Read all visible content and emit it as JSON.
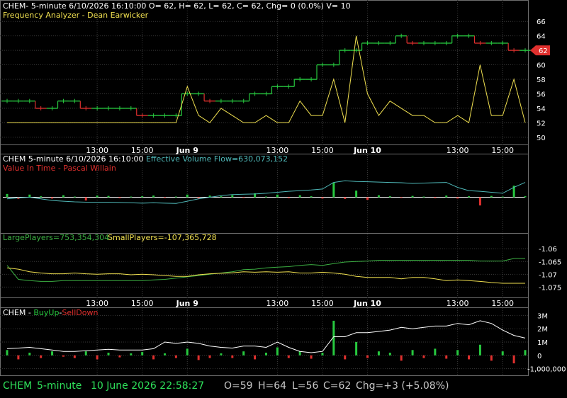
{
  "colors": {
    "background": "#000000",
    "grid": "#3a3a3a",
    "frame": "#6e6e6e",
    "up": "#27c93f",
    "down": "#e0302e",
    "yellow": "#f0e050",
    "cyan": "#4fb8b8",
    "green_line": "#3cb043",
    "white": "#ffffff",
    "status_green": "#2ee05a",
    "price_tag": "#e0302e"
  },
  "x_axis": {
    "tick_labels": [
      "13:00",
      "15:00",
      "Jun 9",
      "13:00",
      "15:00",
      "Jun 10",
      "13:00",
      "15:00"
    ],
    "tick_bold": [
      false,
      false,
      true,
      false,
      false,
      true,
      false,
      false
    ],
    "tick_index": [
      8,
      12,
      16,
      24,
      28,
      32,
      40,
      44
    ],
    "bar_count": 47
  },
  "panel1": {
    "header_line1": "CHEM- 5-minute 6/10/2026 16:10:00 O= 62, H= 62, L= 62, C= 62, Chg= 0 (0.0%) V= 10",
    "header_line2": "Frequency Analyzer - Dean Earwicker",
    "y_ticks": [
      "66",
      "64",
      "62",
      "60",
      "58",
      "56",
      "54",
      "52",
      "50"
    ],
    "last_price_label": "62",
    "chart_data": {
      "type": "line",
      "title": "",
      "ylim": [
        49,
        67
      ],
      "price_steps": [
        55,
        55,
        55,
        54,
        54,
        55,
        55,
        54,
        54,
        54,
        54,
        54,
        53,
        53,
        53,
        53,
        56,
        56,
        55,
        55,
        55,
        55,
        56,
        56,
        57,
        57,
        58,
        58,
        60,
        60,
        62,
        62,
        63,
        63,
        63,
        64,
        63,
        63,
        63,
        63,
        64,
        64,
        63,
        63,
        63,
        62,
        62
      ],
      "frequency": [
        52,
        52,
        52,
        52,
        52,
        52,
        52,
        52,
        52,
        52,
        52,
        52,
        52,
        52,
        52,
        52,
        57,
        53,
        52,
        54,
        53,
        52,
        52,
        53,
        52,
        52,
        55,
        53,
        53,
        58,
        52,
        64,
        56,
        53,
        55,
        54,
        53,
        53,
        52,
        52,
        53,
        52,
        60,
        53,
        53,
        58,
        52
      ]
    }
  },
  "panel2": {
    "header_line1_a": "CHEM 5-minute  6/10/2026 16:10:00 ",
    "header_line1_b": "Effective Volume Flow=630,073,152",
    "header_line2": "Value In Time - Pascal Willain",
    "chart_data": {
      "type": "line",
      "title": "",
      "ylim": [
        -1,
        1
      ],
      "histogram": [
        0.1,
        -0.05,
        0.08,
        0.03,
        -0.04,
        0.06,
        0.02,
        -0.1,
        0.05,
        0.04,
        -0.03,
        0.02,
        0.03,
        0.05,
        -0.02,
        0.02,
        0.08,
        -0.04,
        0.05,
        0.03,
        0.06,
        -0.02,
        0.12,
        0.02,
        0.08,
        -0.03,
        0.06,
        0.03,
        -0.04,
        0.45,
        -0.05,
        0.2,
        -0.08,
        0.06,
        0.03,
        -0.02,
        0.04,
        0.02,
        -0.03,
        0.05,
        -0.04,
        0.03,
        -0.25,
        0.04,
        0.02,
        0.35,
        0.03
      ],
      "effective_volume_flow": [
        -0.05,
        -0.02,
        0.0,
        -0.05,
        -0.1,
        -0.12,
        -0.14,
        -0.15,
        -0.15,
        -0.15,
        -0.16,
        -0.17,
        -0.18,
        -0.17,
        -0.18,
        -0.19,
        -0.12,
        -0.05,
        0.0,
        0.05,
        0.08,
        0.09,
        0.1,
        0.12,
        0.15,
        0.18,
        0.2,
        0.22,
        0.25,
        0.45,
        0.5,
        0.48,
        0.47,
        0.46,
        0.45,
        0.44,
        0.42,
        0.43,
        0.44,
        0.45,
        0.3,
        0.2,
        0.18,
        0.15,
        0.12,
        0.3,
        0.45
      ]
    }
  },
  "panel3": {
    "label_large": "LargePlayers=753,354,304",
    "label_small": "SmallPlayers=-107,365,728",
    "y_ticks": [
      "-1.06",
      "-1.065",
      "-1.07",
      "-1.075"
    ],
    "chart_data": {
      "type": "line",
      "title": "",
      "ylim": [
        -1.0785,
        -1.0555
      ],
      "large_players": [
        -1.0665,
        -1.072,
        -1.0725,
        -1.0728,
        -1.0728,
        -1.0725,
        -1.0725,
        -1.0725,
        -1.0725,
        -1.0725,
        -1.0725,
        -1.0725,
        -1.0725,
        -1.0722,
        -1.072,
        -1.0715,
        -1.071,
        -1.0705,
        -1.07,
        -1.0695,
        -1.069,
        -1.0682,
        -1.068,
        -1.0675,
        -1.0672,
        -1.067,
        -1.0665,
        -1.0662,
        -1.0665,
        -1.0658,
        -1.0652,
        -1.065,
        -1.0648,
        -1.0645,
        -1.0645,
        -1.0645,
        -1.0645,
        -1.0645,
        -1.0645,
        -1.0645,
        -1.0645,
        -1.0645,
        -1.0648,
        -1.0648,
        -1.0648,
        -1.0638,
        -1.0638
      ],
      "small_players": [
        -1.0675,
        -1.068,
        -1.069,
        -1.0695,
        -1.0698,
        -1.0698,
        -1.0695,
        -1.0698,
        -1.07,
        -1.0698,
        -1.0698,
        -1.0702,
        -1.07,
        -1.0702,
        -1.0705,
        -1.0708,
        -1.0708,
        -1.0702,
        -1.0698,
        -1.0696,
        -1.0694,
        -1.069,
        -1.0692,
        -1.069,
        -1.0692,
        -1.069,
        -1.0695,
        -1.0695,
        -1.0692,
        -1.0695,
        -1.07,
        -1.0708,
        -1.0712,
        -1.0712,
        -1.0712,
        -1.0718,
        -1.0712,
        -1.0712,
        -1.0718,
        -1.0725,
        -1.0722,
        -1.0725,
        -1.0728,
        -1.0732,
        -1.0735,
        -1.0735,
        -1.0735
      ]
    }
  },
  "panel4": {
    "label_prefix": "CHEM - ",
    "label_buy": "BuyUp",
    "label_sep": "-",
    "label_sell": "SellDown",
    "y_ticks": [
      "3M",
      "2M",
      "1M",
      "0",
      "-1,000,000"
    ],
    "chart_data": {
      "type": "line",
      "title": "",
      "ylim": [
        -1500000,
        3500000
      ],
      "histogram": [
        400000,
        -300000,
        200000,
        -200000,
        300000,
        -100000,
        -200000,
        300000,
        -300000,
        200000,
        -150000,
        150000,
        250000,
        -300000,
        150000,
        -200000,
        500000,
        -350000,
        -200000,
        150000,
        -200000,
        300000,
        -300000,
        200000,
        600000,
        -200000,
        300000,
        -250000,
        200000,
        2600000,
        -300000,
        1000000,
        -200000,
        300000,
        200000,
        -400000,
        400000,
        -200000,
        500000,
        -250000,
        400000,
        -300000,
        800000,
        -400000,
        300000,
        -600000,
        400000
      ],
      "cumulative": [
        500000,
        550000,
        600000,
        500000,
        400000,
        300000,
        300000,
        350000,
        400000,
        450000,
        400000,
        400000,
        400000,
        500000,
        1000000,
        900000,
        1000000,
        900000,
        700000,
        600000,
        550000,
        700000,
        700000,
        600000,
        1000000,
        600000,
        300000,
        200000,
        300000,
        1400000,
        1400000,
        1700000,
        1700000,
        1800000,
        1900000,
        2100000,
        2000000,
        2100000,
        2200000,
        2200000,
        2400000,
        2300000,
        2600000,
        2400000,
        1900000,
        1500000,
        1300000
      ]
    }
  },
  "status": {
    "symbol": "CHEM",
    "interval": "5-minute",
    "datetime": "10 June 2026 22:58:27",
    "open": "O=59",
    "high": "H=64",
    "low": "L=56",
    "close": "C=62",
    "change": "Chg=+3 (+5.08%)"
  }
}
